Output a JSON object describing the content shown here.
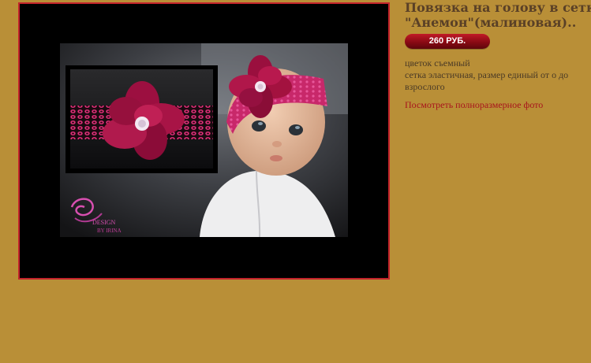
{
  "product": {
    "title_line1": "Повязка на голову в сетку",
    "title_line2": "\"Анемон\"(малиновая)..",
    "price": "260 РУБ.",
    "description_line1": "цветок съемный",
    "description_line2": "сетка эластичная, размер единый от о до",
    "description_line3": "взрослого",
    "full_photo_link": "Посмотреть полноразмерное фото"
  },
  "photo": {
    "watermark_line1": "DESIGN",
    "watermark_line2": "BY IRINA",
    "subject": "baby wearing raspberry flower headband",
    "frame_color": "#c2232b"
  },
  "colors": {
    "page_background": "#b98f37",
    "title": "#5a4026",
    "link": "#a8141c",
    "price_badge": "#8a0a14"
  }
}
